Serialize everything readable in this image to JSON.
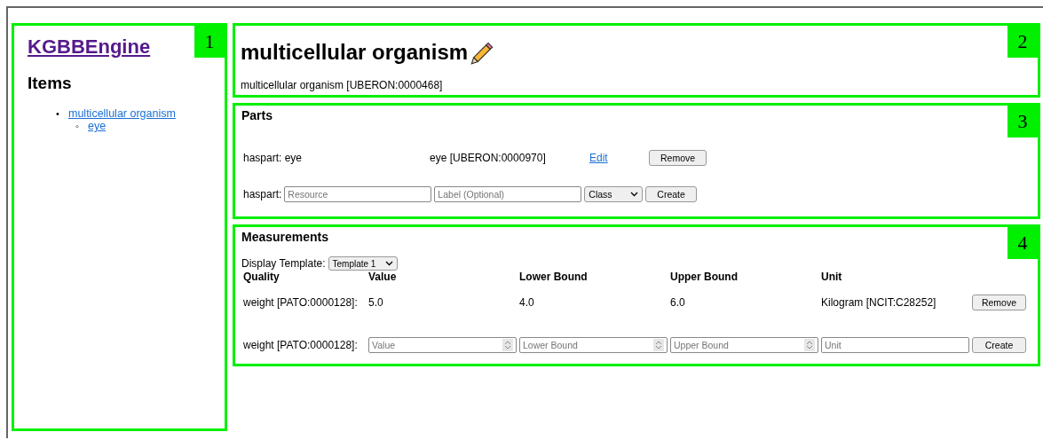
{
  "sidebar": {
    "marker": "1",
    "logo": "KGBBEngine",
    "heading": "Items",
    "tree": [
      {
        "bullet": "•",
        "label": "multicellular organism",
        "children": [
          {
            "bullet": "◦",
            "label": "eye"
          }
        ]
      }
    ]
  },
  "header": {
    "marker": "2",
    "title": "multicellular organism",
    "subtitle": "multicellular organism [UBERON:0000468]"
  },
  "parts": {
    "marker": "3",
    "heading": "Parts",
    "rows": [
      {
        "relation": "haspart: eye",
        "entity": "eye [UBERON:0000970]",
        "link": "Edit",
        "button": "Remove"
      }
    ],
    "form": {
      "label": "haspart:",
      "resource_placeholder": "Resource",
      "label_placeholder": "Label (Optional)",
      "type_value": "Class",
      "button": "Create"
    }
  },
  "measurements": {
    "marker": "4",
    "heading": "Measurements",
    "template_label": "Display Template:",
    "template_value": "Template 1",
    "columns": [
      "Quality",
      "Value",
      "Lower Bound",
      "Upper Bound",
      "Unit"
    ],
    "rows": [
      {
        "cells": [
          "weight [PATO:0000128]:",
          "5.0",
          "4.0",
          "6.0",
          "Kilogram [NCIT:C28252]"
        ],
        "button": "Remove"
      }
    ],
    "form": {
      "label": "weight [PATO:0000128]:",
      "placeholders": [
        "Value",
        "Lower Bound",
        "Upper Bound",
        "Unit"
      ],
      "button": "Create"
    }
  }
}
